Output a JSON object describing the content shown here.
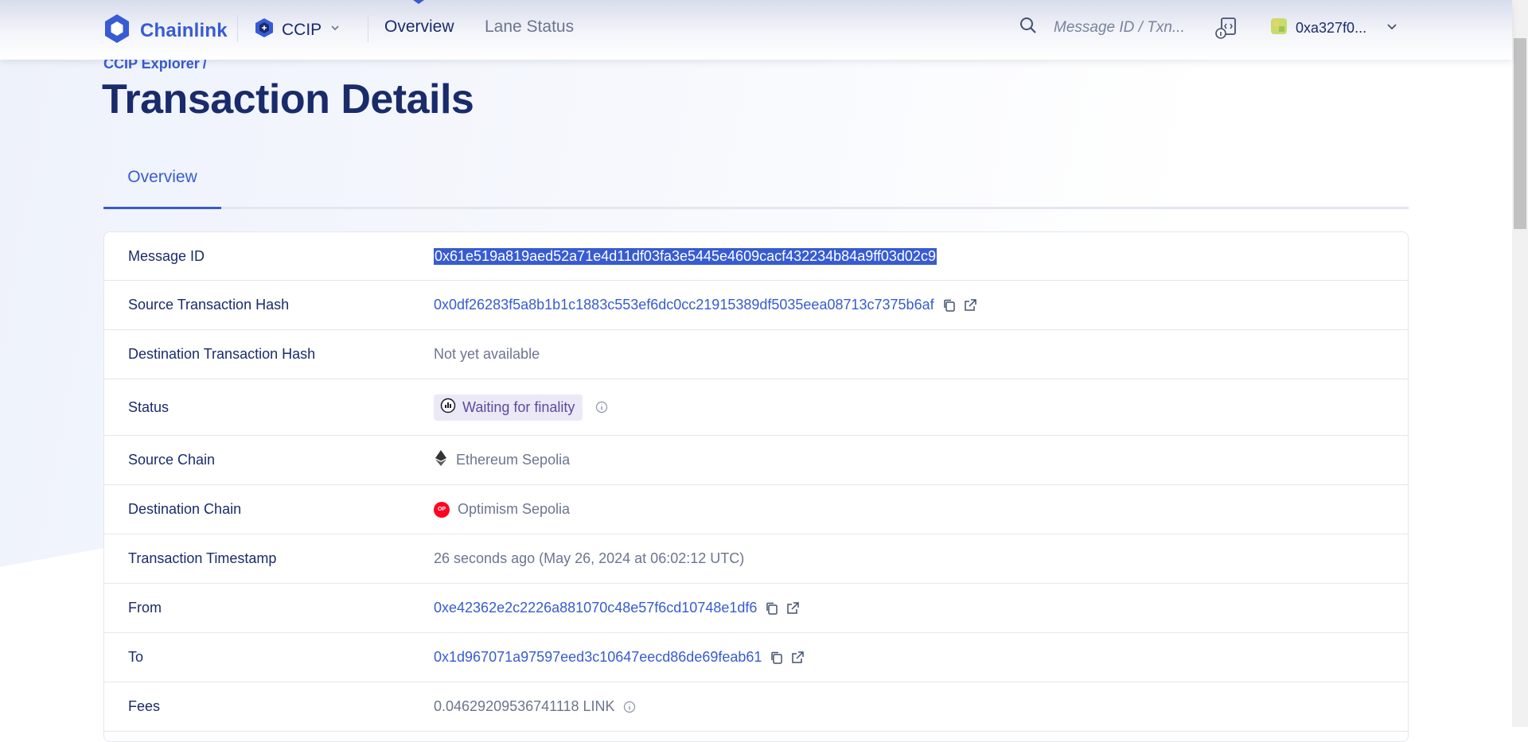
{
  "header": {
    "brand": "Chainlink",
    "product": "CCIP",
    "nav": [
      {
        "label": "Overview"
      },
      {
        "label": "Lane Status"
      }
    ],
    "search_placeholder": "Message ID / Txn...",
    "wallet_address": "0xa327f0..."
  },
  "breadcrumb": {
    "root": "CCIP Explorer",
    "separator": "/"
  },
  "page_title": "Transaction Details",
  "tabs": [
    {
      "label": "Overview"
    }
  ],
  "details": {
    "message_id": {
      "label": "Message ID",
      "value": "0x61e519a819aed52a71e4d11df03fa3e5445e4609cacf432234b84a9ff03d02c9"
    },
    "source_tx_hash": {
      "label": "Source Transaction Hash",
      "value": "0x0df26283f5a8b1b1c1883c553ef6dc0cc21915389df5035eea08713c7375b6af"
    },
    "dest_tx_hash": {
      "label": "Destination Transaction Hash",
      "value": "Not yet available"
    },
    "status": {
      "label": "Status",
      "value": "Waiting for finality"
    },
    "source_chain": {
      "label": "Source Chain",
      "value": "Ethereum Sepolia"
    },
    "dest_chain": {
      "label": "Destination Chain",
      "value": "Optimism Sepolia",
      "badge": "OP"
    },
    "timestamp": {
      "label": "Transaction Timestamp",
      "value": "26 seconds ago (May 26, 2024 at 06:02:12 UTC)"
    },
    "from": {
      "label": "From",
      "value": "0xe42362e2c2226a881070c48e57f6cd10748e1df6"
    },
    "to": {
      "label": "To",
      "value": "0x1d967071a97597eed3c10647eecd86de69feab61"
    },
    "fees": {
      "label": "Fees",
      "value": "0.04629209536741118 LINK"
    }
  },
  "colors": {
    "accent": "#375bd2",
    "navy": "#1a2b6b",
    "muted": "#6c7590",
    "status_bg": "#ece9f7",
    "op_red": "#ff0420"
  },
  "icons": [
    "chainlink-logo-icon",
    "ccip-icon",
    "chevron-down-icon",
    "search-icon",
    "developer-icon",
    "wallet-avatar-icon",
    "copy-icon",
    "external-link-icon",
    "finality-icon",
    "info-icon",
    "ethereum-icon",
    "optimism-icon"
  ]
}
